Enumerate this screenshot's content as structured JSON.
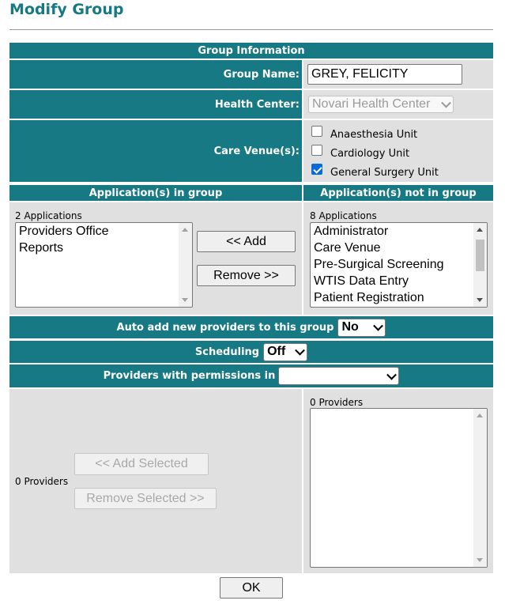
{
  "page": {
    "title": "Modify Group"
  },
  "group_info": {
    "header": "Group Information",
    "group_name_label": "Group Name:",
    "group_name_value": "GREY, FELICITY",
    "health_center_label": "Health Center:",
    "health_center_value": "Novari Health Center",
    "care_venue_label": "Care Venue(s):",
    "care_venues": [
      {
        "label": "Anaesthesia Unit",
        "checked": false
      },
      {
        "label": "Cardiology Unit",
        "checked": false
      },
      {
        "label": "General Surgery Unit",
        "checked": true
      }
    ]
  },
  "applications": {
    "in_group_header": "Application(s) in group",
    "not_in_group_header": "Application(s) not in group",
    "in_group_count": "2 Applications",
    "in_group_items": [
      "Providers Office",
      "Reports"
    ],
    "add_button": "<< Add",
    "remove_button": "Remove >>",
    "not_in_group_count": "8 Applications",
    "not_in_group_items": [
      "Administrator",
      "Care Venue",
      "Pre-Surgical Screening",
      "WTIS Data Entry",
      "Patient Registration"
    ]
  },
  "auto_add": {
    "label": "Auto add new providers to this group",
    "value": "No"
  },
  "scheduling": {
    "label": "Scheduling",
    "value": "Off"
  },
  "providers_permissions": {
    "label": "Providers with permissions in",
    "value": ""
  },
  "providers": {
    "left_count": "0 Providers",
    "add_selected_button": "<< Add Selected",
    "remove_selected_button": "Remove Selected >>",
    "right_count": "0 Providers"
  },
  "ok_button": "OK",
  "colors": {
    "header_teal": "#167984",
    "panel_grey": "#e0e0e0",
    "checkbox_blue": "#0a6ad6"
  }
}
